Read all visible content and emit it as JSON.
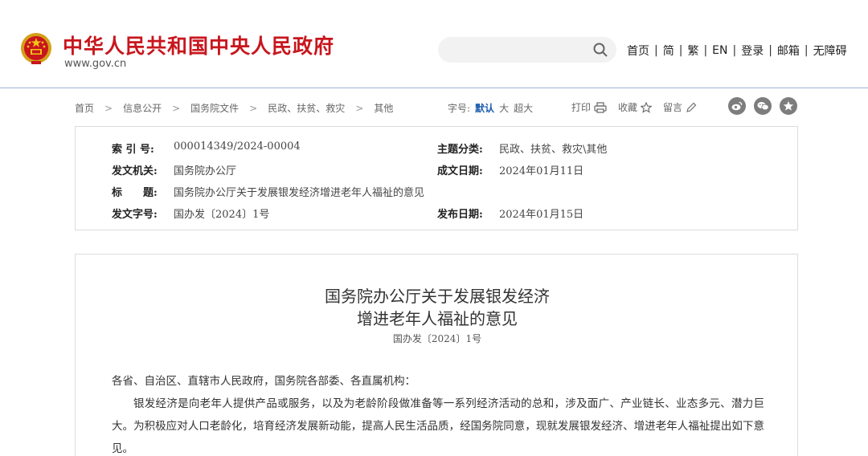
{
  "header": {
    "site_title": "中华人民共和国中央人民政府",
    "site_url": "www.gov.cn",
    "search_placeholder": "",
    "nav": [
      "首页",
      "简",
      "繁",
      "EN",
      "登录",
      "邮箱",
      "无障碍"
    ],
    "nav_separator": "|"
  },
  "breadcrumb": {
    "items": [
      "首页",
      "信息公开",
      "国务院文件",
      "民政、扶贫、救灾",
      "其他"
    ],
    "arrow": ">"
  },
  "font_size": {
    "label": "字号:",
    "options": [
      "默认",
      "大",
      "超大"
    ],
    "selected": "默认"
  },
  "tools": {
    "print": "打印",
    "favorite": "收藏",
    "comment": "留言"
  },
  "share_icons": [
    "weibo-icon",
    "wechat-icon",
    "qzone-icon"
  ],
  "info": {
    "index_label": "索 引 号:",
    "index_value": "000014349/2024-00004",
    "category_label": "主题分类:",
    "category_value": "民政、扶贫、救灾\\其他",
    "issuer_label": "发文机关:",
    "issuer_value": "国务院办公厅",
    "date_label": "成文日期:",
    "date_value": "2024年01月11日",
    "title_label": "标　　题:",
    "title_value": "国务院办公厅关于发展银发经济增进老年人福祉的意见",
    "doc_no_label": "发文字号:",
    "doc_no_value": "国办发〔2024〕1号",
    "publish_label": "发布日期:",
    "publish_value": "2024年01月15日"
  },
  "document": {
    "title_line1": "国务院办公厅关于发展银发经济",
    "title_line2": "增进老年人福祉的意见",
    "number": "国办发〔2024〕1号",
    "salutation": "各省、自治区、直辖市人民政府，国务院各部委、各直属机构：",
    "paragraph1": "银发经济是向老年人提供产品或服务，以及为老龄阶段做准备等一系列经济活动的总和，涉及面广、产业链长、业态多元、潜力巨大。为积极应对人口老龄化，培育经济发展新动能，提高人民生活品质，经国务院同意，现就发展银发经济、增进老年人福祉提出如下意见。"
  },
  "colors": {
    "brand_red": "#c8161d",
    "header_border": "#9fb3d3",
    "link_blue": "#1a5dab",
    "share_grey": "#7d7d7d"
  }
}
